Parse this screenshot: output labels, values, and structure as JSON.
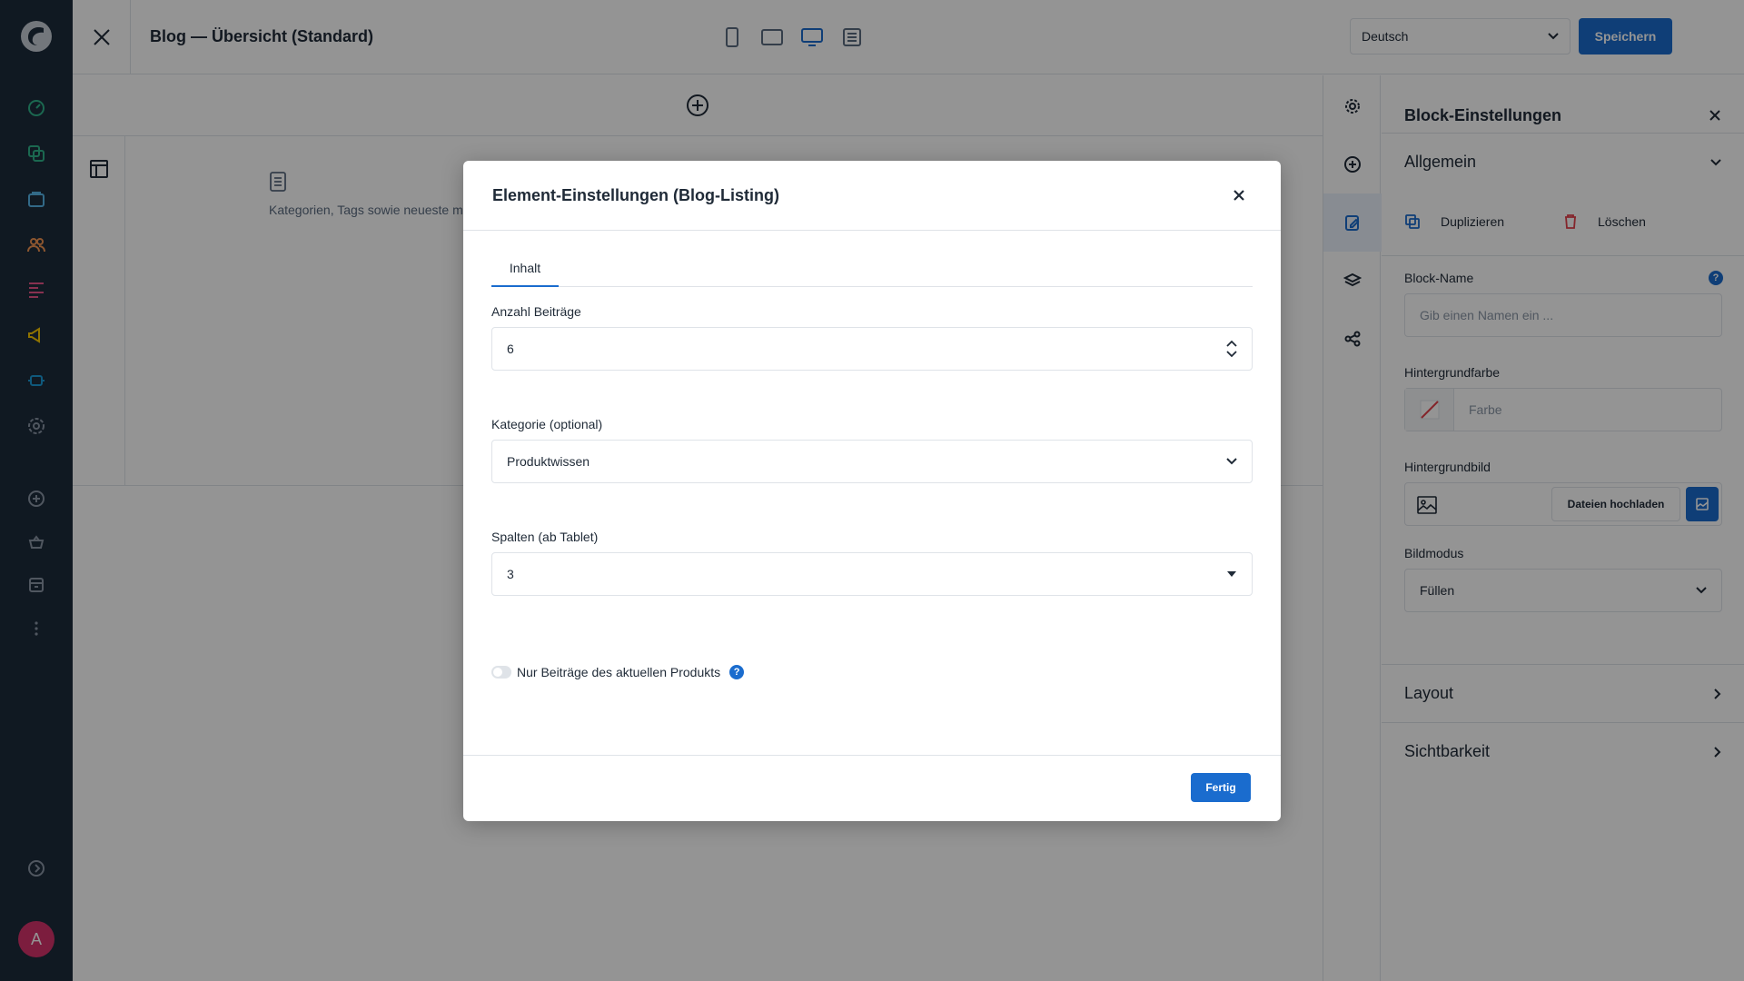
{
  "app": {
    "page_title": "Blog — Übersicht (Standard)",
    "language": "Deutsch",
    "save_label": "Speichern",
    "user_initial": "A",
    "accent_color": "#1a6cce"
  },
  "nav": {
    "icons": [
      "dashboard-icon",
      "catalogue-icon",
      "orders-icon",
      "customers-icon",
      "content-icon",
      "marketing-icon",
      "extensions-icon",
      "settings-icon",
      "add-icon",
      "sales-channel-icon",
      "storefront-icon",
      "more-icon",
      "expand-icon"
    ]
  },
  "canvas": {
    "element_text": "Kategorien, Tags sowie neueste meistgelesene Beiträge."
  },
  "panel": {
    "title": "Block-Einstellungen",
    "section_general": "Allgemein",
    "duplicate": "Duplizieren",
    "delete": "Löschen",
    "block_name_label": "Block-Name",
    "block_name_placeholder": "Gib einen Namen ein ...",
    "bg_color_label": "Hintergrundfarbe",
    "bg_color_placeholder": "Farbe",
    "bg_image_label": "Hintergrundbild",
    "upload_label": "Dateien hochladen",
    "image_mode_label": "Bildmodus",
    "image_mode_value": "Füllen",
    "section_layout": "Layout",
    "section_visibility": "Sichtbarkeit"
  },
  "modal": {
    "title": "Element-Einstellungen (Blog-Listing)",
    "tab_content": "Inhalt",
    "count_label": "Anzahl Beiträge",
    "count_value": "6",
    "category_label": "Kategorie (optional)",
    "category_value": "Produktwissen",
    "columns_label": "Spalten (ab Tablet)",
    "columns_value": "3",
    "toggle_label": "Nur Beiträge des aktuellen Produkts",
    "help_mark": "?",
    "done_label": "Fertig"
  }
}
